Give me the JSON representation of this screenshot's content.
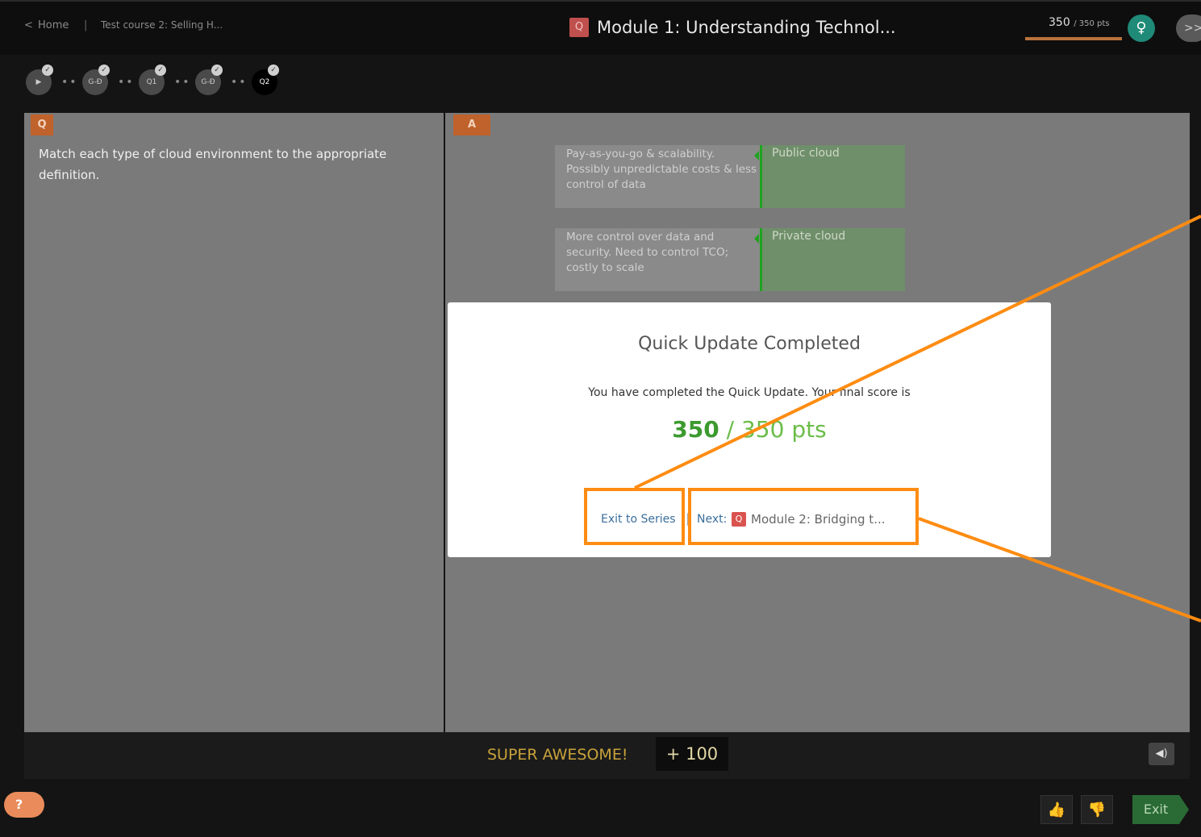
{
  "header": {
    "home_label": "Home",
    "breadcrumb_sep": "|",
    "course_title": "Test course 2: Selling H...",
    "module_badge": "Q",
    "module_title": "Module 1: Understanding Technol...",
    "points_value": "350",
    "points_total": "/ 350 pts",
    "forward_label": ">>"
  },
  "progress": {
    "steps": [
      {
        "label": "▶",
        "completed": true
      },
      {
        "label": "G-Ð",
        "completed": true
      },
      {
        "label": "Q1",
        "completed": true
      },
      {
        "label": "G-Ð",
        "completed": true
      },
      {
        "label": "Q2",
        "completed": true,
        "current": true
      }
    ],
    "check_mark": "✓",
    "dots": "••"
  },
  "question_panel": {
    "tag": "Q",
    "text": "Match each type of cloud environment to the appropriate definition."
  },
  "answer_panel": {
    "tag": "A",
    "pairs": [
      {
        "definition": "Pay-as-you-go & scalability. Possibly unpredictable costs & less control of data",
        "answer": "Public cloud"
      },
      {
        "definition": "More control over data and security. Need to control TCO; costly to scale",
        "answer": "Private cloud"
      }
    ]
  },
  "modal": {
    "title": "Quick Update Completed",
    "message": "You have completed the Quick Update. Your final score is",
    "score": "350",
    "score_total": "/ 350 pts",
    "exit_label": "Exit to Series",
    "separator": "|",
    "next_label": "Next:",
    "next_badge": "Q",
    "next_title": "Module 2: Bridging t..."
  },
  "feedback": {
    "text": "SUPER AWESOME!",
    "bonus": "+ 100",
    "sound_icon": "◀)"
  },
  "footer": {
    "chat_icon": "?",
    "thumbs_up": "👍",
    "thumbs_down": "👎",
    "exit_label": "Exit"
  },
  "colors": {
    "highlight": "#ff8c12",
    "accent_orange": "#c0622b",
    "score_green": "#3c9a2f",
    "match_green": "#1fa31f"
  }
}
